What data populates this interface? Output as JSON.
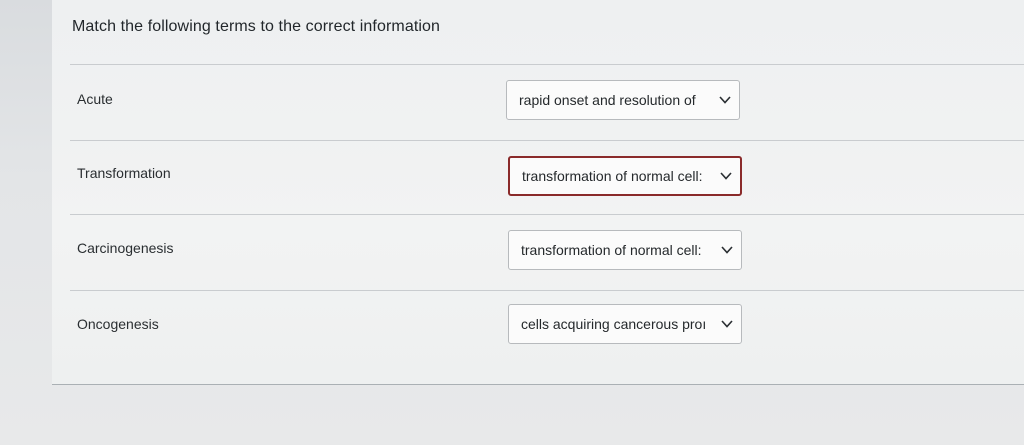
{
  "question": {
    "prompt": "Match the following terms to the correct information"
  },
  "matches": [
    {
      "term": "Acute",
      "selected": "rapid onset and resolution of"
    },
    {
      "term": "Transformation",
      "selected": "transformation of normal cell:"
    },
    {
      "term": "Carcinogenesis",
      "selected": "transformation of normal cell:"
    },
    {
      "term": "Oncogenesis",
      "selected": "cells acquiring cancerous proı"
    }
  ],
  "icons": {
    "dropdown": "chevron-down-icon"
  },
  "colors": {
    "focus_border": "#8a2a2a",
    "divider": "#c9cccf"
  }
}
